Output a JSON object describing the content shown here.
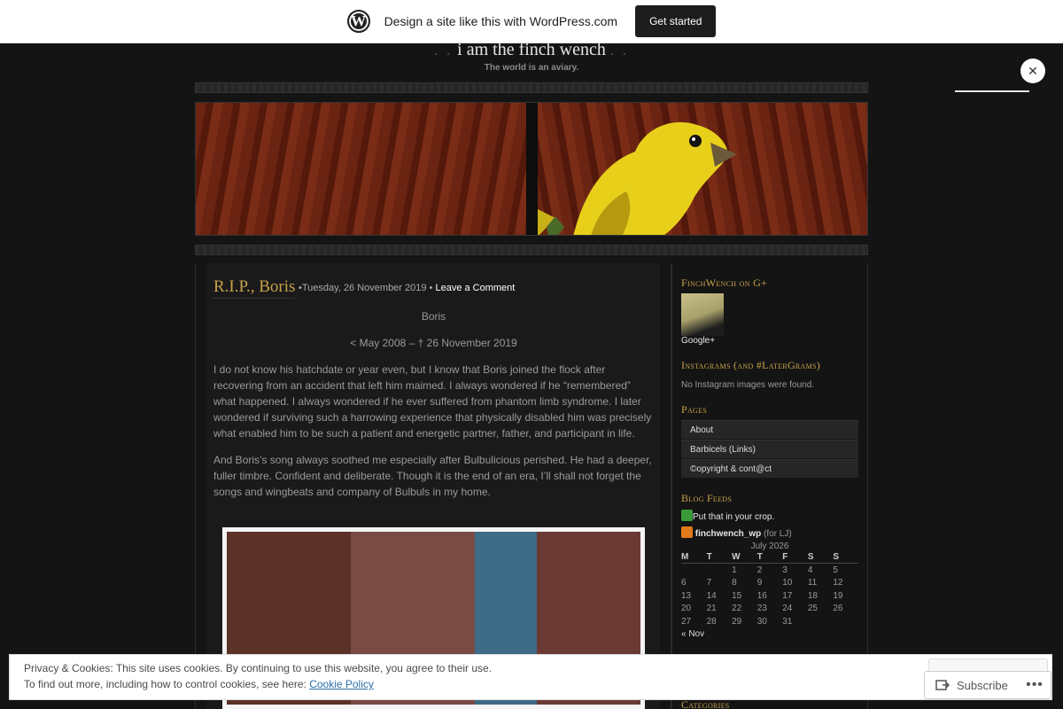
{
  "wpbar": {
    "logo": "W",
    "text": "Design a site like this with WordPress.com",
    "button": "Get started"
  },
  "header": {
    "dots_left": ". .",
    "title": "i am the finch wench",
    "dots_right": ". .",
    "description": "The world is an aviary."
  },
  "close_button": "✕",
  "post": {
    "title": "R.I.P., Boris",
    "meta_prefix": "•Tuesday, 26 November 2019 •",
    "leave_comment": "Leave a Comment",
    "name": "Boris",
    "dates": "< May 2008 – † 26 November 2019",
    "paragraph1": "I do not know his hatchdate or year even, but I know that Boris joined the flock after recovering from an accident that left him maimed.  I always wondered if he “remembered” what happened.  I always wondered if he ever suffered from phantom limb syndrome.  I later wondered if surviving such a harrowing experience that physically disabled him was precisely what enabled him to be such a patient and energetic partner, father, and participant in life.",
    "paragraph2": "And Boris’s song always soothed me especially after Bulbulicious perished.  He had a deeper, fuller timbre.  Confident and deliberate.  Though it is the end of an era, I’ll shall not forget the songs and wingbeats and company of Bulbuls in my home."
  },
  "sidebar": {
    "gplus_heading": "FinchWench on G+",
    "gplus_label": "Google+",
    "instagram_heading": "Instagrams (and #LaterGrams)",
    "instagram_empty": "No Instagram images were found.",
    "pages_heading": "Pages",
    "pages": [
      {
        "label": "About"
      },
      {
        "label": "Barbicels (Links)"
      },
      {
        "label": "©opyright & cont@ct"
      }
    ],
    "feeds_heading": "Blog Feeds",
    "feed1": "Put that in your crop.",
    "feed2_name": "finchwench_wp",
    "feed2_suffix": " (for LJ)",
    "categories_heading": "Categories"
  },
  "calendar": {
    "caption": "July 2026",
    "headers": [
      "M",
      "T",
      "W",
      "T",
      "F",
      "S",
      "S"
    ],
    "rows": [
      [
        "",
        "",
        "1",
        "2",
        "3",
        "4",
        "5"
      ],
      [
        "6",
        "7",
        "8",
        "9",
        "10",
        "11",
        "12"
      ],
      [
        "13",
        "14",
        "15",
        "16",
        "17",
        "18",
        "19"
      ],
      [
        "20",
        "21",
        "22",
        "23",
        "24",
        "25",
        "26"
      ],
      [
        "27",
        "28",
        "29",
        "30",
        "31",
        "",
        ""
      ]
    ],
    "prev": "« Nov"
  },
  "cookie": {
    "line1": "Privacy & Cookies: This site uses cookies. By continuing to use this website, you agree to their use.",
    "line2_prefix": "To find out more, including how to control cookies, see here: ",
    "policy_link": "Cookie Policy"
  },
  "subscribe": {
    "label": "Subscribe",
    "more": "•••"
  },
  "colors": {
    "accent_gold": "#c9a24a",
    "background": "#141414",
    "link_blue": "#2a6fa8"
  }
}
